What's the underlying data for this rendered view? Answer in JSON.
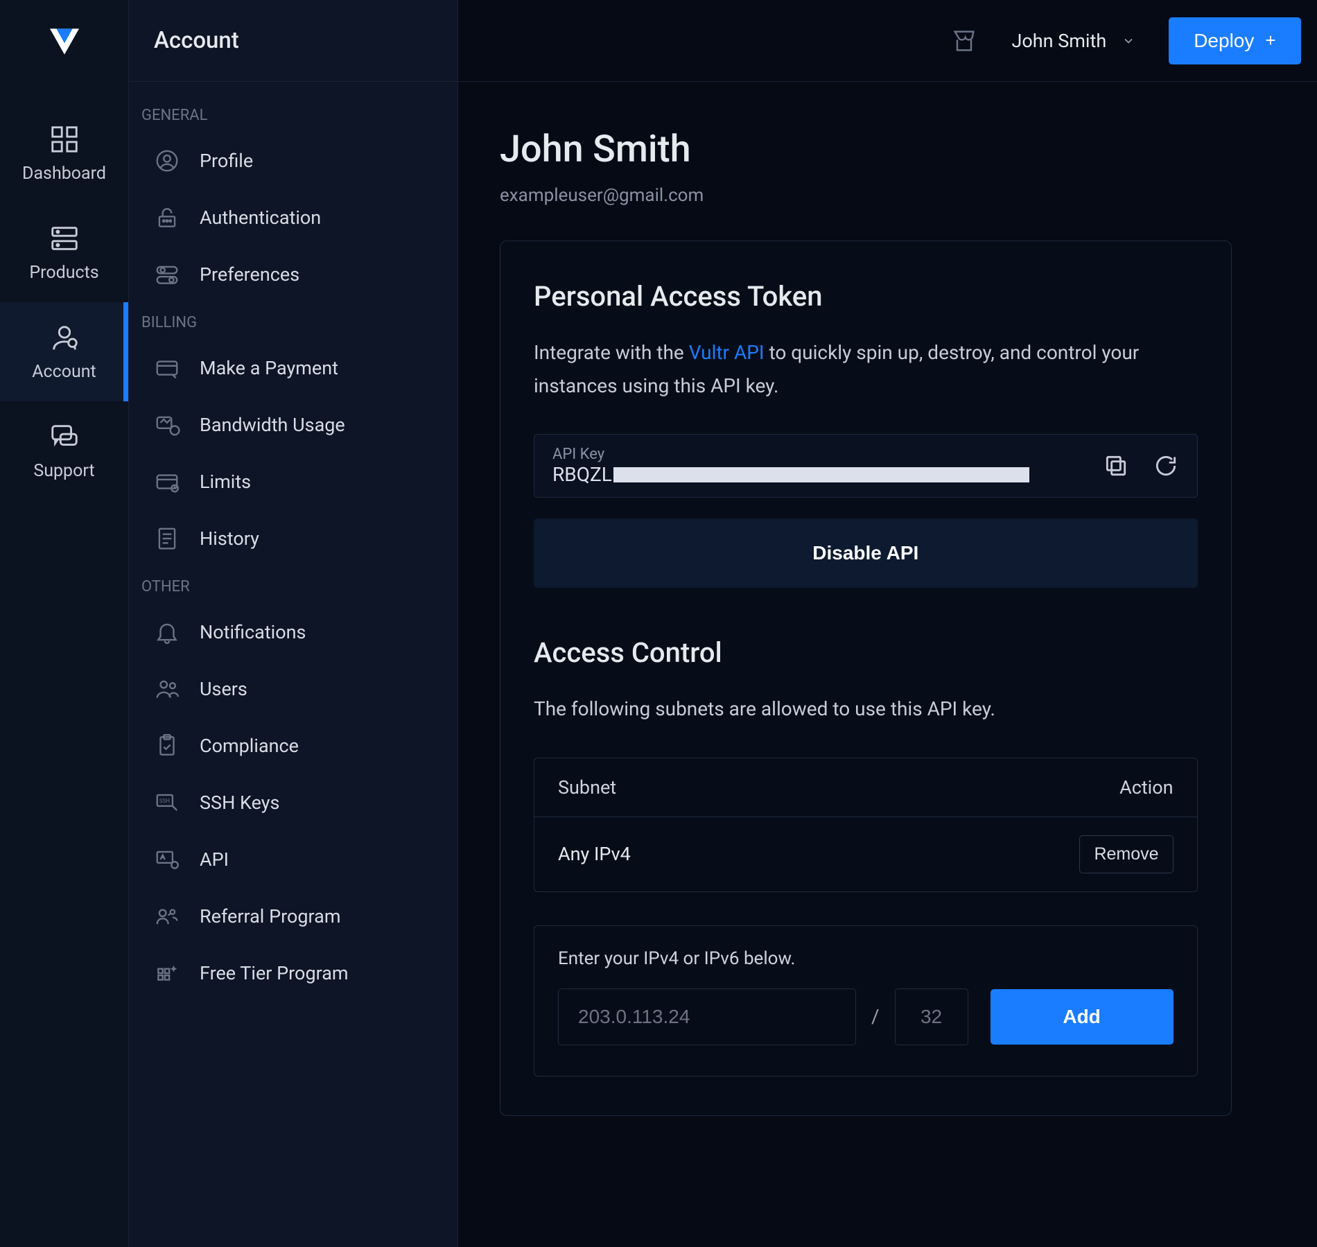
{
  "rail": {
    "items": [
      {
        "label": "Dashboard"
      },
      {
        "label": "Products"
      },
      {
        "label": "Account"
      },
      {
        "label": "Support"
      }
    ]
  },
  "subnav_title": "Account",
  "subnav": {
    "general_label": "GENERAL",
    "billing_label": "BILLING",
    "other_label": "OTHER",
    "general": [
      {
        "label": "Profile"
      },
      {
        "label": "Authentication"
      },
      {
        "label": "Preferences"
      }
    ],
    "billing": [
      {
        "label": "Make a Payment"
      },
      {
        "label": "Bandwidth Usage"
      },
      {
        "label": "Limits"
      },
      {
        "label": "History"
      }
    ],
    "other": [
      {
        "label": "Notifications"
      },
      {
        "label": "Users"
      },
      {
        "label": "Compliance"
      },
      {
        "label": "SSH Keys"
      },
      {
        "label": "API"
      },
      {
        "label": "Referral Program"
      },
      {
        "label": "Free Tier Program"
      }
    ]
  },
  "topbar": {
    "user_name": "John Smith",
    "deploy_label": "Deploy"
  },
  "page": {
    "title": "John Smith",
    "email": "exampleuser@gmail.com"
  },
  "pat": {
    "title": "Personal Access Token",
    "desc_pre": "Integrate with the ",
    "desc_link": "Vultr API",
    "desc_post": " to quickly spin up, destroy, and control your instances using this API key.",
    "api_key_label": "API Key",
    "api_key_value_prefix": "RBQZL",
    "disable_label": "Disable API"
  },
  "access": {
    "title": "Access Control",
    "desc": "The following subnets are allowed to use this API key.",
    "col_subnet": "Subnet",
    "col_action": "Action",
    "rows": [
      {
        "subnet": "Any IPv4",
        "action_label": "Remove"
      }
    ],
    "form_instruction": "Enter your IPv4 or IPv6 below.",
    "ip_placeholder": "203.0.113.24",
    "mask_placeholder": "32",
    "slash": "/",
    "add_label": "Add"
  }
}
